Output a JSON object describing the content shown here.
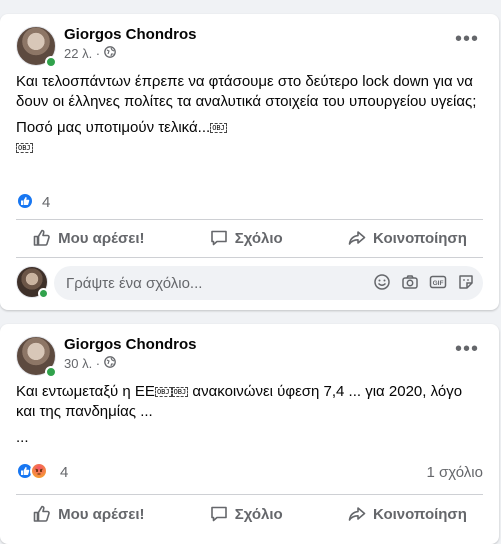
{
  "posts": [
    {
      "author": "Giorgos Chondros",
      "time": "22 λ. ·",
      "paragraphs": [
        "Και τελοσπάντων έπρεπε να φτάσουμε στο δεύτερο lock down για να δουν οι έλληνες πολίτες τα αναλυτικά στοιχεία του υπουργείου υγείας;",
        "Ποσό μας υποτιμούν τελικά..."
      ],
      "obj_marker": "OBJ",
      "reaction_count": "4",
      "comment_count": ""
    },
    {
      "author": "Giorgos Chondros",
      "time": "30 λ. ·",
      "text_before": "Και εντωμεταξύ η  ΕΕ",
      "text_after": " ανακοινώνει ύφεση 7,4 ... για 2020, λόγο και της πανδημίας ...",
      "text_line2": "...",
      "obj_marker": "OBJ",
      "reaction_count": "4",
      "comment_count": "1 σχόλιο"
    }
  ],
  "actions": {
    "like": "Μου αρέσει!",
    "comment": "Σχόλιο",
    "share": "Κοινοποίηση"
  },
  "comment_input": {
    "placeholder": "Γράψτε ένα σχόλιο..."
  },
  "colors": {
    "background": "#f0f2f5",
    "online": "#31a24c",
    "like": "#1877f2",
    "angry": "#f35369",
    "secondary_text": "#65676b"
  }
}
